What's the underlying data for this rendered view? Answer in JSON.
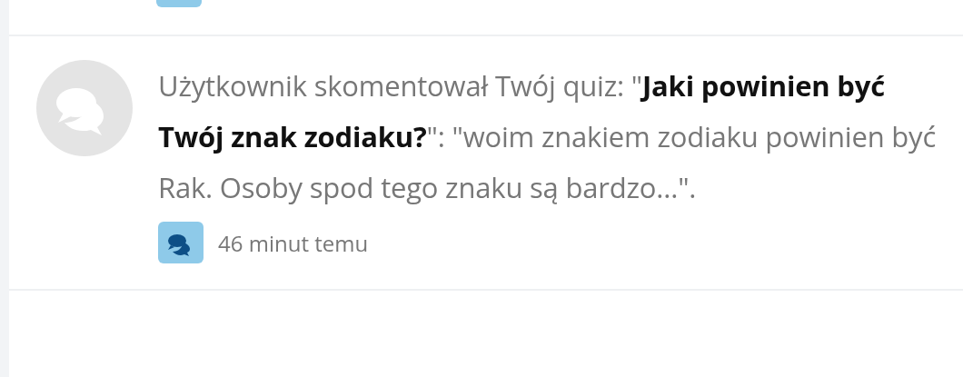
{
  "notifications": [
    {
      "message": "Użytkownik skomentował Twój quiz: \"**Jaki powinien być Twój znak zodiaku?**\": \"woim znakiem zodiaku powinien być Rak. Osoby spod tego znaku są bardzo...\".",
      "time": "46 minut temu"
    }
  ]
}
